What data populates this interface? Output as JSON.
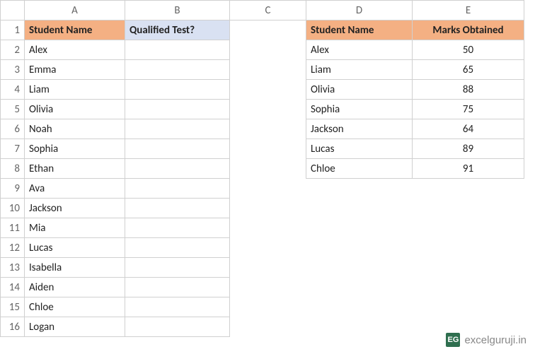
{
  "columns": [
    "A",
    "B",
    "C",
    "D",
    "E"
  ],
  "rows": [
    "1",
    "2",
    "3",
    "4",
    "5",
    "6",
    "7",
    "8",
    "9",
    "10",
    "11",
    "12",
    "13",
    "14",
    "15",
    "16"
  ],
  "left": {
    "header_a": "Student Name",
    "header_b": "Qualified Test?",
    "students": [
      "Alex",
      "Emma",
      "Liam",
      "Olivia",
      "Noah",
      "Sophia",
      "Ethan",
      "Ava",
      "Jackson",
      "Mia",
      "Lucas",
      "Isabella",
      "Aiden",
      "Chloe",
      "Logan"
    ]
  },
  "right": {
    "header_d": "Student Name",
    "header_e": "Marks Obtained",
    "rows": [
      {
        "name": "Alex",
        "marks": "50"
      },
      {
        "name": "Liam",
        "marks": "65"
      },
      {
        "name": "Olivia",
        "marks": "88"
      },
      {
        "name": "Sophia",
        "marks": "75"
      },
      {
        "name": "Jackson",
        "marks": "64"
      },
      {
        "name": "Lucas",
        "marks": "89"
      },
      {
        "name": "Chloe",
        "marks": "91"
      }
    ]
  },
  "watermark": {
    "logo": "EG",
    "text": "excelguruji.in"
  }
}
